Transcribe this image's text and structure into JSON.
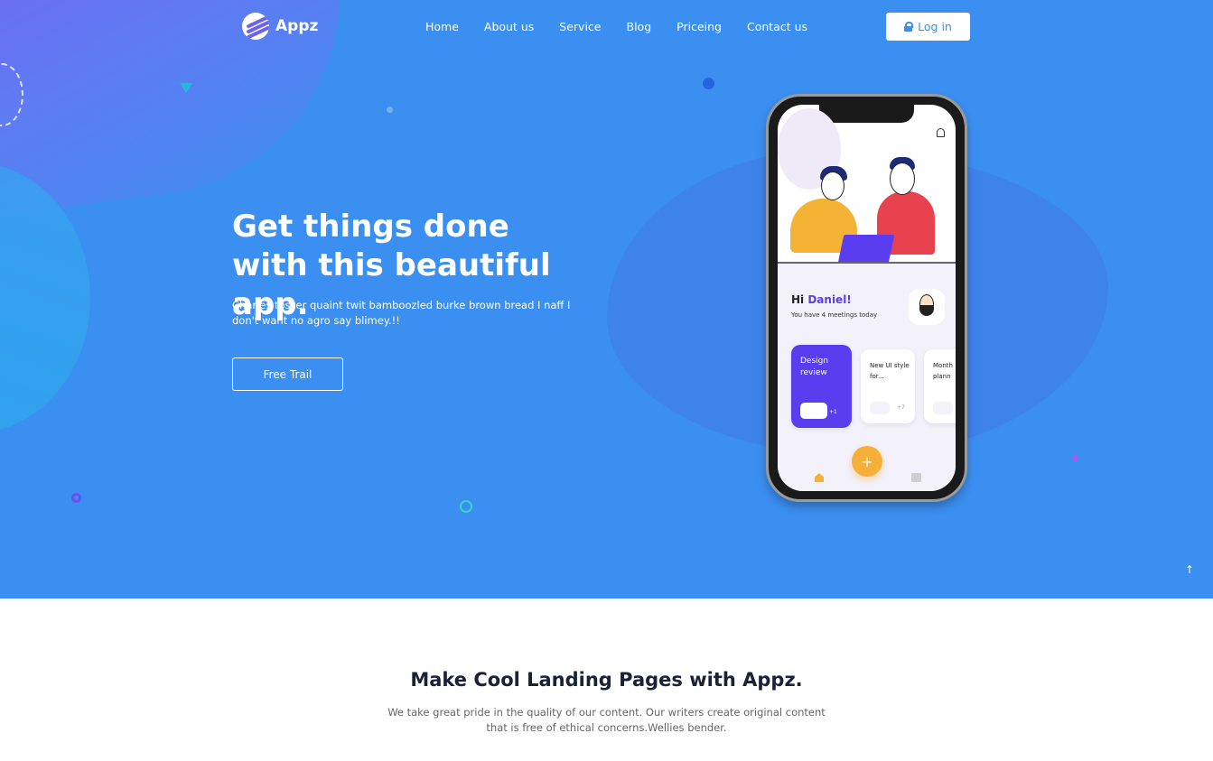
{
  "brand": {
    "name": "Appz"
  },
  "nav": {
    "items": [
      "Home",
      "About us",
      "Service",
      "Blog",
      "Priceing",
      "Contact us"
    ]
  },
  "login": {
    "label": "Log in"
  },
  "hero": {
    "headline": "Get things done with this beautiful app.",
    "subtext": "Charles tosser quaint twit bamboozled burke brown bread I naff I don't want no agro say blimey.!!",
    "cta_label": "Free Trail"
  },
  "phone": {
    "greeting_prefix": "Hi",
    "greeting_name": "Daniel!",
    "meetings_text": "You have 4 meetings today",
    "cards": [
      {
        "title": "Design review",
        "extra": "+1"
      },
      {
        "title": "New UI style for...",
        "extra": "+7"
      },
      {
        "title": "Month plann",
        "extra": ""
      }
    ],
    "fab_label": "+"
  },
  "section2": {
    "title": "Make Cool Landing Pages with Appz.",
    "text": "We take great pride in the quality of our content. Our writers create original content that is free of ethical concerns.Wellies bender."
  },
  "colors": {
    "hero_bg": "#3b8ff0",
    "accent_purple": "#5b3df0",
    "accent_orange": "#f6b03a",
    "title_dark": "#1a2238"
  },
  "icons": [
    "logo-icon",
    "lock-icon",
    "menu-icon",
    "bell-icon",
    "home-icon",
    "calendar-icon",
    "arrow-up-icon"
  ]
}
